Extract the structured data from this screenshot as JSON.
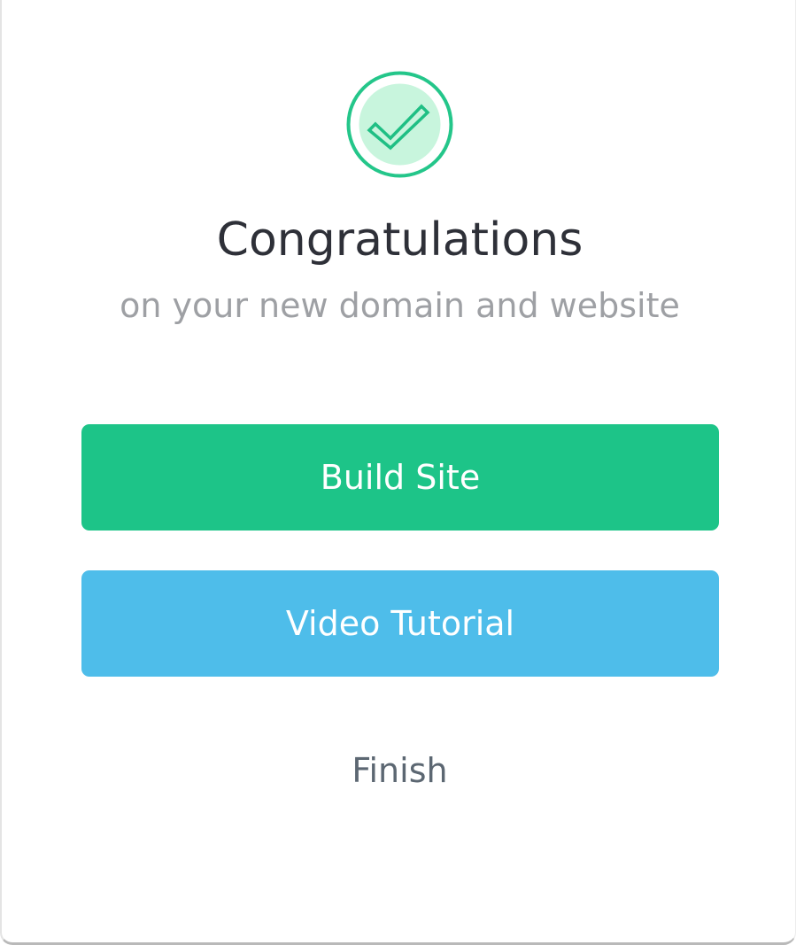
{
  "dialog": {
    "icon": "checkmark-circle-icon",
    "title": "Congratulations",
    "subtitle": "on your new domain and website",
    "build_site_label": "Build Site",
    "video_tutorial_label": "Video Tutorial",
    "finish_label": "Finish"
  },
  "colors": {
    "build_button": "#1dc488",
    "video_button": "#4ebdea",
    "icon_ring": "#24c68a",
    "icon_fill": "#c8f5dd"
  }
}
